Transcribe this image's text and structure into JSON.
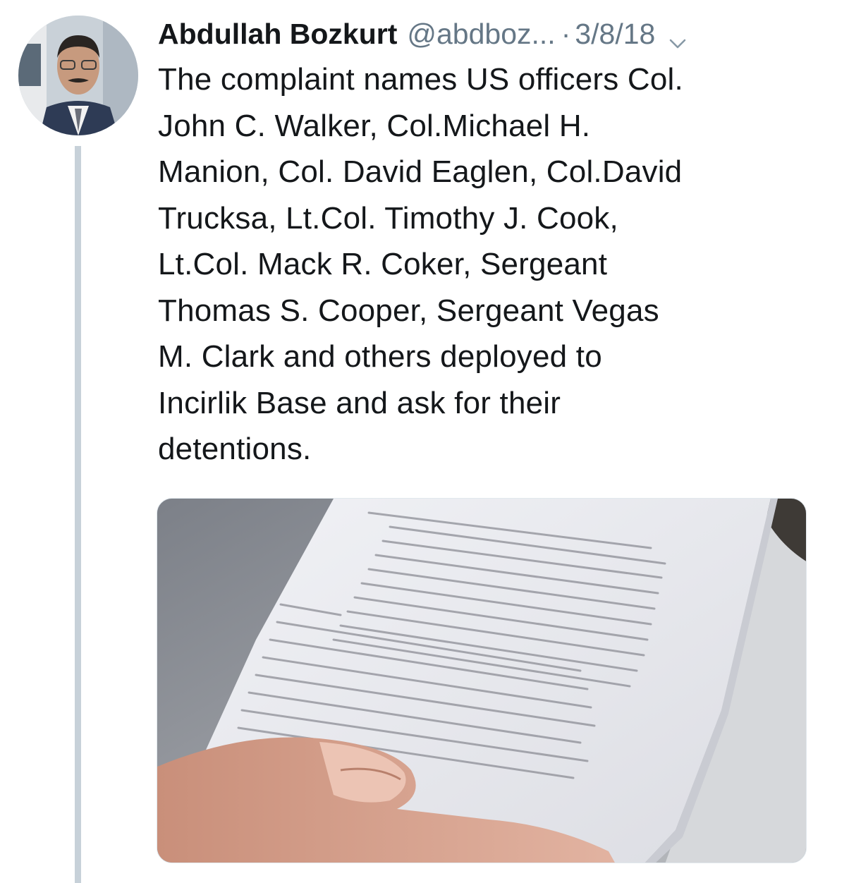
{
  "tweet": {
    "author_name": "Abdullah Bozkurt",
    "handle": "@abdboz...",
    "separator": "·",
    "date": "3/8/18",
    "text_lines": [
      "The complaint names US officers Col.",
      "John C. Walker, Col.Michael H.",
      "Manion, Col. David Eaglen, Col.David",
      "Trucksa, Lt.Col. Timothy J. Cook,",
      "Lt.Col. Mack R. Coker, Sergeant",
      "Thomas S. Cooper, Sergeant Vegas",
      "M. Clark and others deployed to",
      "Incirlik Base and ask for their",
      "detentions."
    ]
  },
  "icons": {
    "avatar": "avatar-photo",
    "menu": "chevron-down-icon"
  },
  "colors": {
    "text": "#14171a",
    "secondary": "#657786",
    "thread_line": "#c7d1d9"
  }
}
